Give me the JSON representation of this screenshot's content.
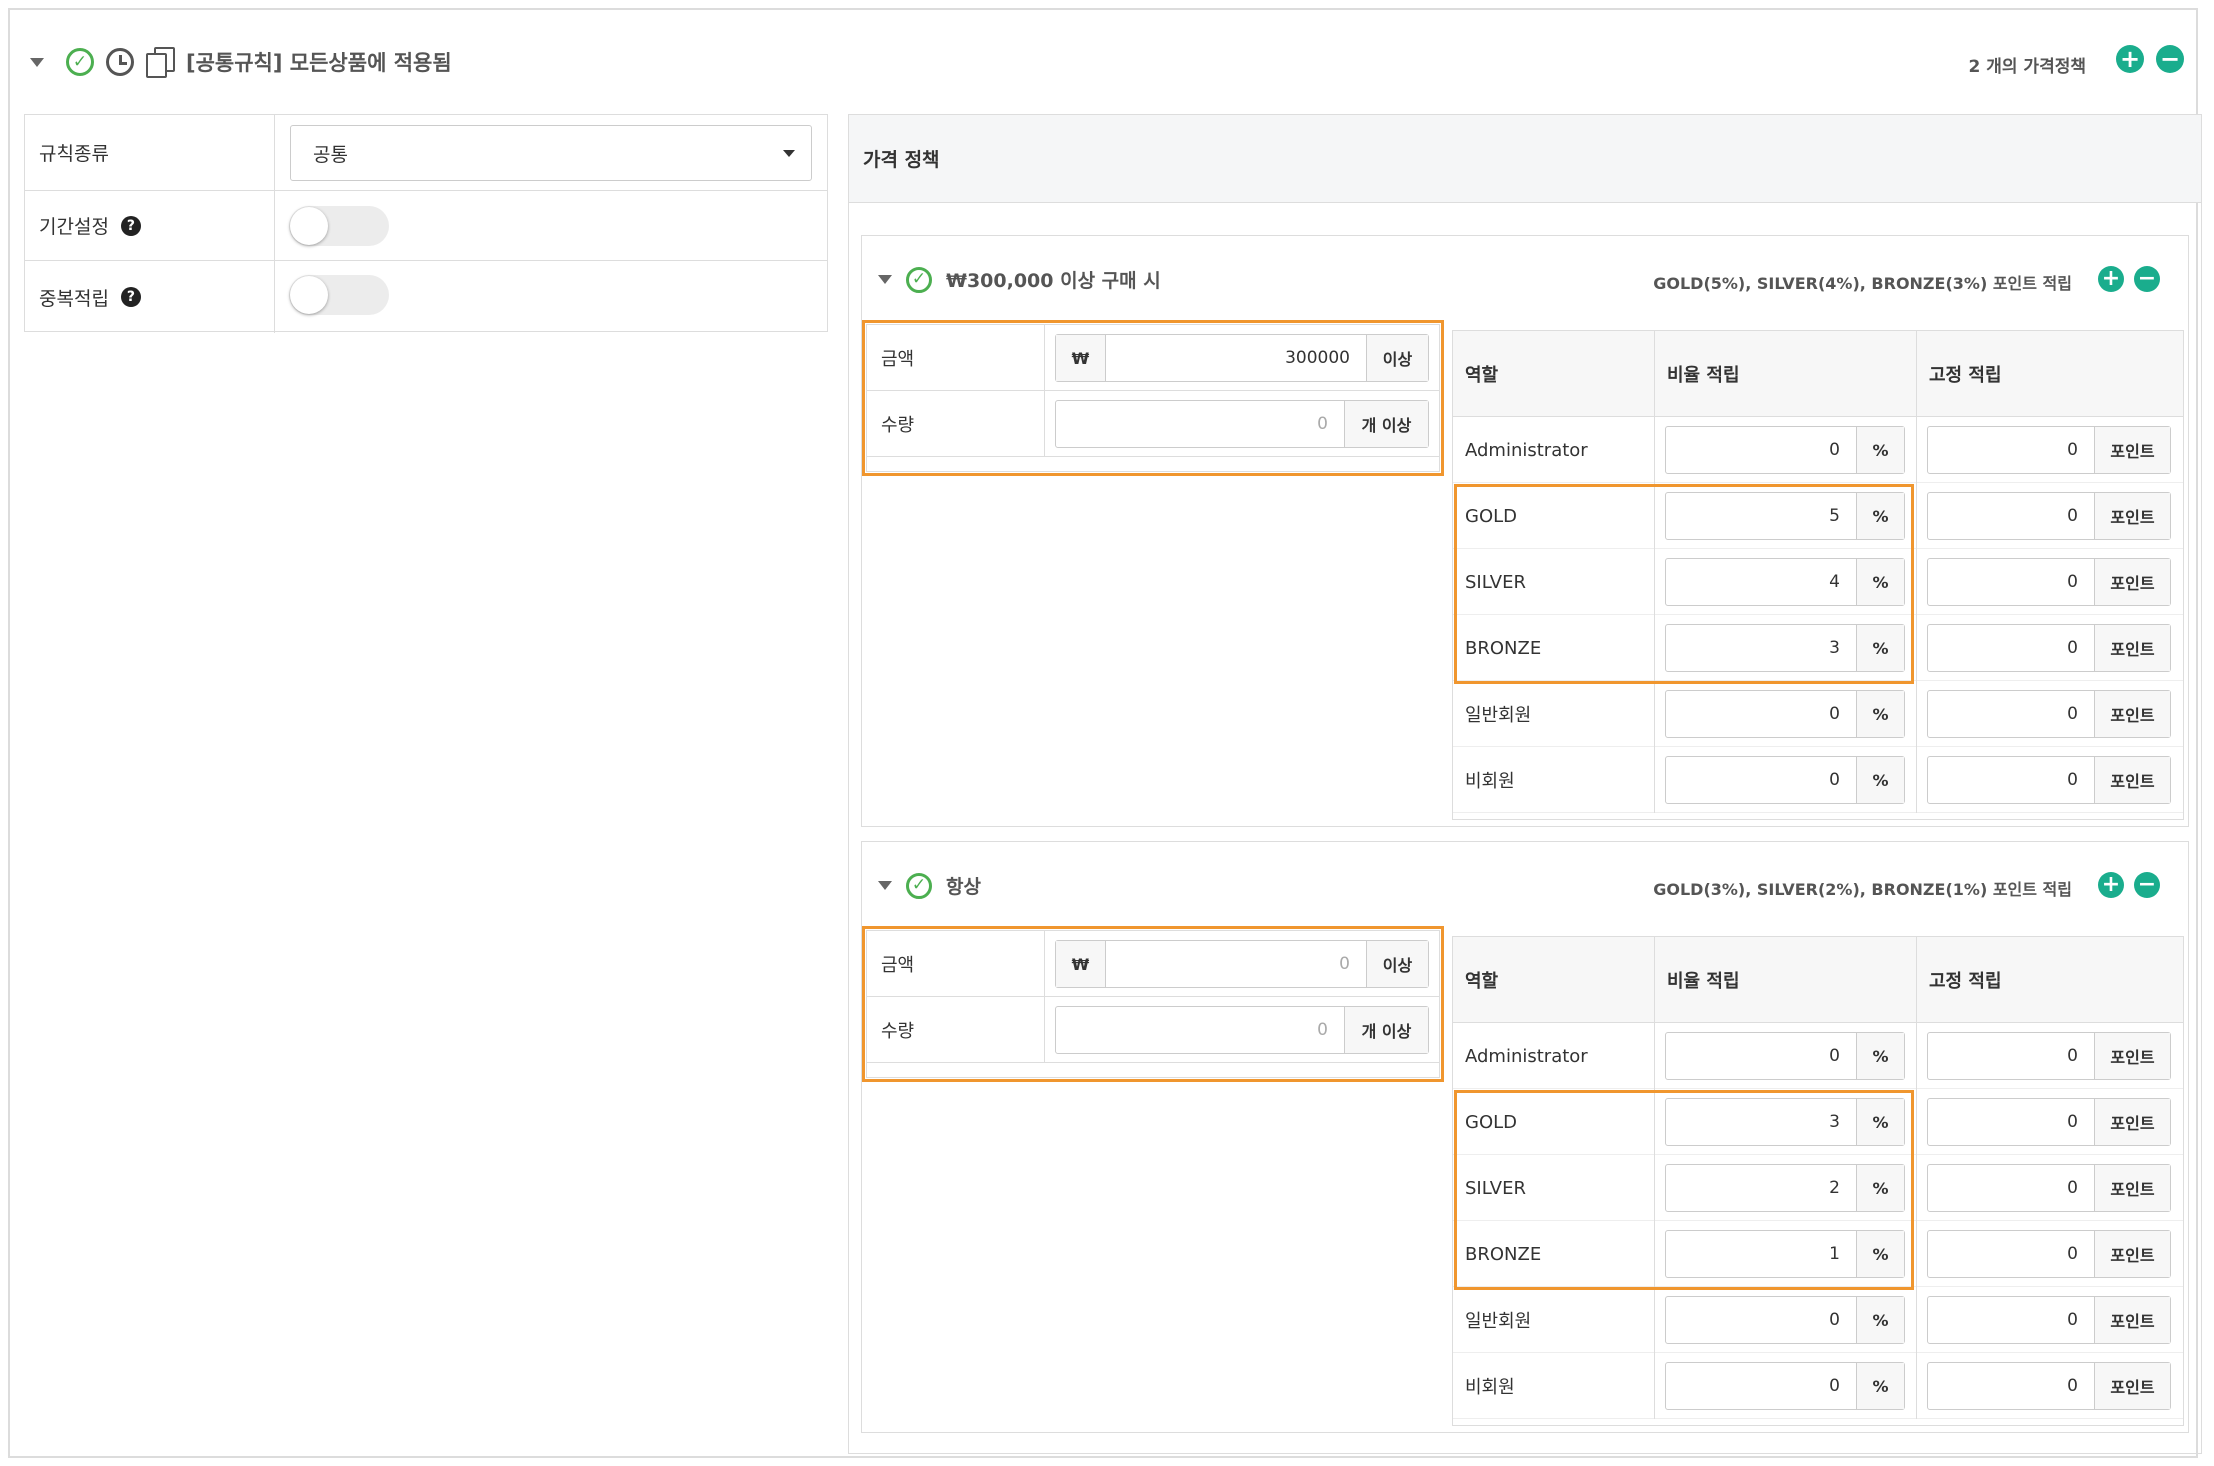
{
  "header": {
    "title": "[공통규칙] 모든상품에 적용됨",
    "count_label": "2 개의 가격정책"
  },
  "settings": {
    "rule_type_label": "규칙종류",
    "rule_type_value": "공통",
    "period_label": "기간설정",
    "duplicate_label": "중복적립"
  },
  "policy": {
    "title": "가격 정책",
    "cards": [
      {
        "title": "₩300,000 이상 구매 시",
        "summary": "GOLD(5%), SILVER(4%), BRONZE(3%) 포인트 적립",
        "amount_label": "금액",
        "amount_prefix": "₩",
        "amount_value": "300000",
        "amount_suffix": "이상",
        "qty_label": "수량",
        "qty_value": "0",
        "qty_suffix": "개 이상",
        "table_headers": {
          "role": "역할",
          "rate": "비율 적립",
          "fixed": "고정 적립"
        },
        "rows": [
          {
            "role": "Administrator",
            "rate": "0",
            "fixed": "0"
          },
          {
            "role": "GOLD",
            "rate": "5",
            "fixed": "0"
          },
          {
            "role": "SILVER",
            "rate": "4",
            "fixed": "0"
          },
          {
            "role": "BRONZE",
            "rate": "3",
            "fixed": "0"
          },
          {
            "role": "일반회원",
            "rate": "0",
            "fixed": "0"
          },
          {
            "role": "비회원",
            "rate": "0",
            "fixed": "0"
          }
        ]
      },
      {
        "title": "항상",
        "summary": "GOLD(3%), SILVER(2%), BRONZE(1%) 포인트 적립",
        "amount_label": "금액",
        "amount_prefix": "₩",
        "amount_value": "0",
        "amount_suffix": "이상",
        "qty_label": "수량",
        "qty_value": "0",
        "qty_suffix": "개 이상",
        "table_headers": {
          "role": "역할",
          "rate": "비율 적립",
          "fixed": "고정 적립"
        },
        "rows": [
          {
            "role": "Administrator",
            "rate": "0",
            "fixed": "0"
          },
          {
            "role": "GOLD",
            "rate": "3",
            "fixed": "0"
          },
          {
            "role": "SILVER",
            "rate": "2",
            "fixed": "0"
          },
          {
            "role": "BRONZE",
            "rate": "1",
            "fixed": "0"
          },
          {
            "role": "일반회원",
            "rate": "0",
            "fixed": "0"
          },
          {
            "role": "비회원",
            "rate": "0",
            "fixed": "0"
          }
        ]
      }
    ]
  },
  "units": {
    "percent": "%",
    "point": "포인트"
  },
  "colors": {
    "accent": "#1aad8d",
    "check": "#4caf50",
    "highlight": "#f0962e"
  }
}
